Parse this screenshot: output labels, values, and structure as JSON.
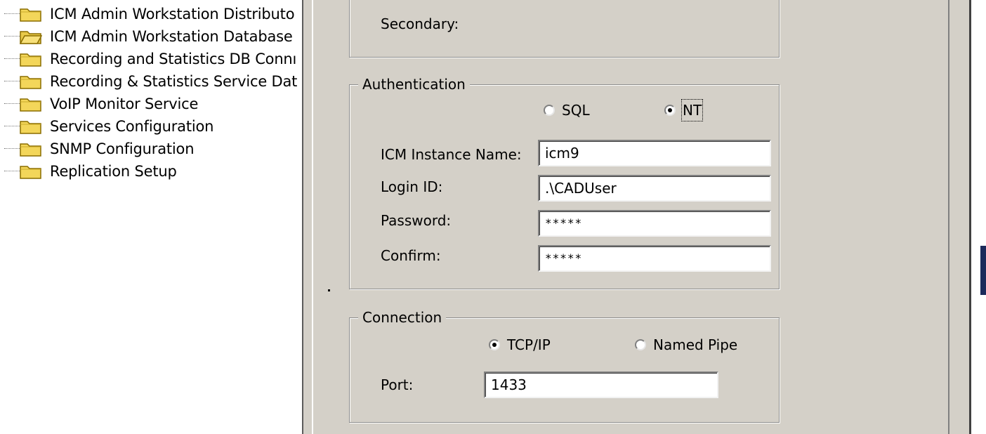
{
  "tree": {
    "items": [
      {
        "label": "ICM Admin Workstation Distributo",
        "icon": "folder-icon"
      },
      {
        "label": "ICM Admin Workstation Database",
        "icon": "folder-open-icon"
      },
      {
        "label": "Recording and Statistics DB Connı",
        "icon": "folder-icon"
      },
      {
        "label": "Recording & Statistics Service Dat",
        "icon": "folder-icon"
      },
      {
        "label": "VoIP Monitor Service",
        "icon": "folder-icon"
      },
      {
        "label": "Services Configuration",
        "icon": "folder-icon"
      },
      {
        "label": "SNMP Configuration",
        "icon": "folder-icon"
      },
      {
        "label": "Replication Setup",
        "icon": "folder-icon"
      }
    ]
  },
  "server_group": {
    "secondary_label": "Secondary:"
  },
  "authentication": {
    "title": "Authentication",
    "options": [
      {
        "label": "SQL",
        "checked": false
      },
      {
        "label": "NT",
        "checked": true
      }
    ],
    "instance_label": "ICM Instance Name:",
    "instance_value": "icm9",
    "login_label": "Login ID:",
    "login_value": ".\\CADUser",
    "password_label": "Password:",
    "password_value": "*****",
    "confirm_label": "Confirm:",
    "confirm_value": "*****"
  },
  "connection": {
    "title": "Connection",
    "options": [
      {
        "label": "TCP/IP",
        "checked": true
      },
      {
        "label": "Named Pipe",
        "checked": false
      }
    ],
    "port_label": "Port:",
    "port_value": "1433"
  },
  "colors": {
    "dialog_bg": "#d4d0c8",
    "folder_yellow": "#f3d65a",
    "accent": "#1c2a5b"
  }
}
